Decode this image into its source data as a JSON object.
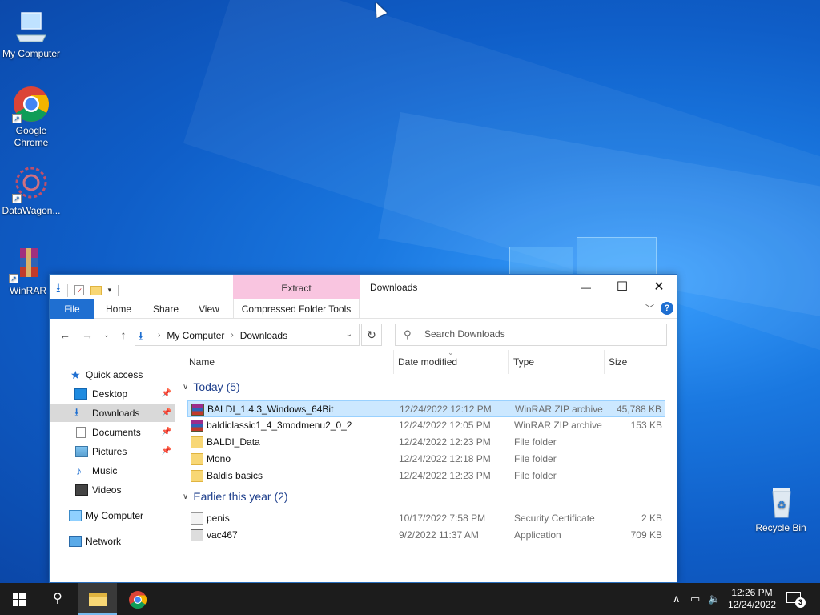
{
  "desktop": {
    "icons": [
      {
        "label": "My Computer",
        "icon": "computer-icon"
      },
      {
        "label": "Google Chrome",
        "icon": "chrome-icon"
      },
      {
        "label": "DataWagon...",
        "icon": "datawagon-icon"
      },
      {
        "label": "WinRAR",
        "icon": "winrar-icon"
      },
      {
        "label": "Recycle Bin",
        "icon": "recycle-bin-icon"
      }
    ]
  },
  "explorer": {
    "title": "Downloads",
    "context_tab": "Extract",
    "window_buttons": {
      "minimize": "—",
      "maximize": "☐",
      "close": "✕"
    },
    "ribbon_tabs": [
      "File",
      "Home",
      "Share",
      "View",
      "Compressed Folder Tools"
    ],
    "address": {
      "crumbs": [
        "My Computer",
        "Downloads"
      ]
    },
    "search": {
      "placeholder": "Search Downloads"
    },
    "sidebar": [
      {
        "label": "Quick access",
        "pinned": false
      },
      {
        "label": "Desktop",
        "pinned": true
      },
      {
        "label": "Downloads",
        "pinned": true,
        "selected": true
      },
      {
        "label": "Documents",
        "pinned": true
      },
      {
        "label": "Pictures",
        "pinned": true
      },
      {
        "label": "Music",
        "pinned": false
      },
      {
        "label": "Videos",
        "pinned": false
      },
      {
        "label": "My Computer",
        "pinned": false
      },
      {
        "label": "Network",
        "pinned": false
      }
    ],
    "columns": [
      "Name",
      "Date modified",
      "Type",
      "Size"
    ],
    "groups": [
      {
        "label": "Today (5)",
        "rows": [
          {
            "name": "BALDI_1.4.3_Windows_64Bit",
            "date": "12/24/2022 12:12 PM",
            "type": "WinRAR ZIP archive",
            "size": "45,788 KB",
            "icon": "rar",
            "selected": true
          },
          {
            "name": "baldiclassic1_4_3modmenu2_0_2",
            "date": "12/24/2022 12:05 PM",
            "type": "WinRAR ZIP archive",
            "size": "153 KB",
            "icon": "rar"
          },
          {
            "name": "BALDI_Data",
            "date": "12/24/2022 12:23 PM",
            "type": "File folder",
            "size": "",
            "icon": "folder"
          },
          {
            "name": "Mono",
            "date": "12/24/2022 12:18 PM",
            "type": "File folder",
            "size": "",
            "icon": "folder"
          },
          {
            "name": "Baldis basics",
            "date": "12/24/2022 12:23 PM",
            "type": "File folder",
            "size": "",
            "icon": "folder"
          }
        ]
      },
      {
        "label": "Earlier this year (2)",
        "rows": [
          {
            "name": "penis",
            "date": "10/17/2022 7:58 PM",
            "type": "Security Certificate",
            "size": "2 KB",
            "icon": "cert"
          },
          {
            "name": "vac467",
            "date": "9/2/2022 11:37 AM",
            "type": "Application",
            "size": "709 KB",
            "icon": "app"
          }
        ]
      }
    ]
  },
  "taskbar": {
    "clock_time": "12:26 PM",
    "clock_date": "12/24/2022",
    "notification_count": "3",
    "accent": "#76b9ed"
  }
}
